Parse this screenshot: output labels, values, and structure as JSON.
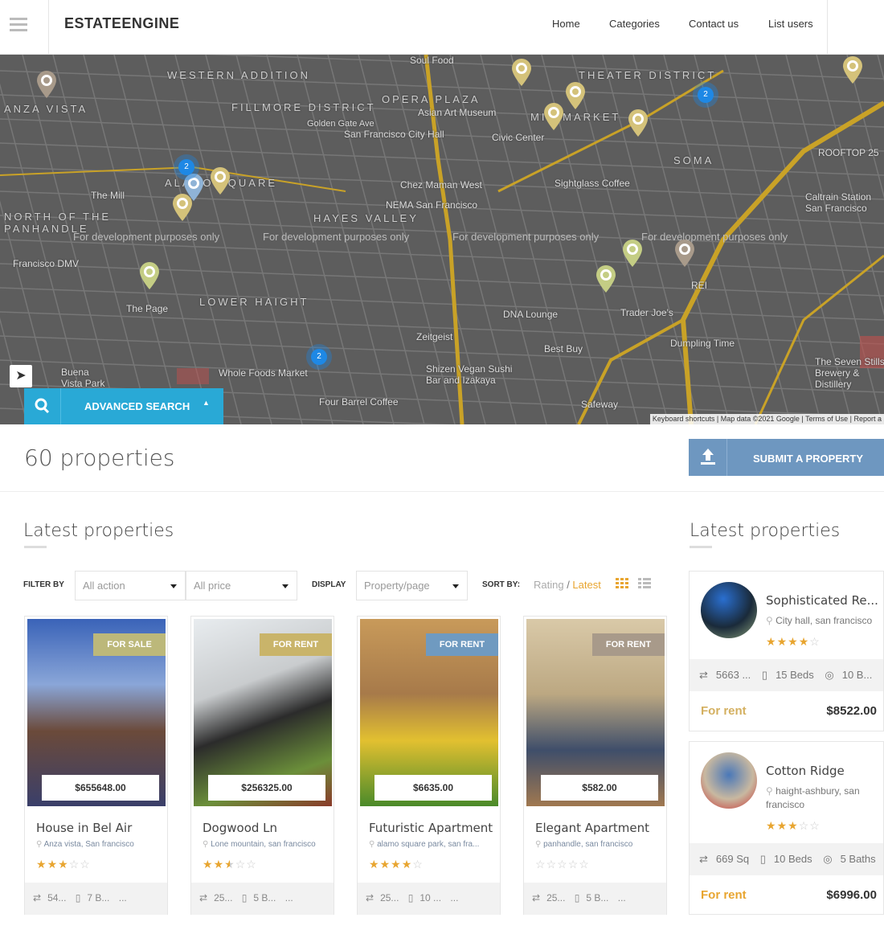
{
  "header": {
    "logo": "ESTATEENGINE",
    "nav": [
      "Home",
      "Categories",
      "Contact us",
      "List users"
    ]
  },
  "map": {
    "neighborhoods": [
      "WESTERN ADDITION",
      "ANZA VISTA",
      "FILLMORE DISTRICT",
      "OPERA PLAZA",
      "THEATER DISTRICT",
      "SOMA",
      "ALAMO SQUARE",
      "NORTH OF THE PANHANDLE",
      "HAYES VALLEY",
      "LOWER HAIGHT",
      "MID-MARKET"
    ],
    "places": [
      "Soul Food",
      "Asian Art Museum",
      "San Francisco City Hall",
      "Civic Center",
      "Sightglass Coffee",
      "Chez Maman West",
      "NEMA San Francisco",
      "Golden Gate Ave",
      "The Mill",
      "The Page",
      "Whole Foods Market",
      "Zeitgeist",
      "Shizen Vegan Sushi Bar and Izakaya",
      "Four Barrel Coffee",
      "DNA Lounge",
      "Trader Joe's",
      "Best Buy",
      "Safeway",
      "Dumpling Time",
      "The Seven Stills Brewery & Distillery",
      "ROOFTOP 25",
      "Caltrain Station San Francisco",
      "REI",
      "Buena Vista Park",
      "Francisco DMV"
    ],
    "watermark": "For development purposes only",
    "clusters": [
      "2",
      "2",
      "2"
    ],
    "attribution": [
      "Keyboard shortcuts",
      "Map data ©2021 Google",
      "Terms of Use",
      "Report a"
    ]
  },
  "advanced_search": "ADVANCED SEARCH",
  "count": "60 properties",
  "submit": "SUBMIT A PROPERTY",
  "main_title": "Latest properties",
  "side_title": "Latest properties",
  "filters": {
    "filter_by": "FILTER BY",
    "action": "All action",
    "price": "All price",
    "display": "DISPLAY",
    "per_page": "Property/page",
    "sort_by": "SORT BY:",
    "rating": "Rating",
    "slash": " / ",
    "latest": "Latest"
  },
  "colors": {
    "accent": "#29a9d6",
    "submit": "#6e97c0",
    "star": "#e8a530",
    "for_rent_text": "#d4b060"
  },
  "cards": [
    {
      "badge": "FOR SALE",
      "badge_color": "#bcb87a",
      "price": "$655648.00",
      "title": "House in Bel Air",
      "location": "Anza vista, San francisco",
      "rating": 3,
      "area": "54...",
      "beds": "7 B...",
      "more": "..."
    },
    {
      "badge": "FOR RENT",
      "badge_color": "#c9b46a",
      "price": "$256325.00",
      "title": "Dogwood Ln",
      "location": "Lone mountain, san francisco",
      "rating": 2.5,
      "area": "25...",
      "beds": "5 B...",
      "more": "..."
    },
    {
      "badge": "FOR RENT",
      "badge_color": "#6f9ac0",
      "price": "$6635.00",
      "title": "Futuristic Apartment",
      "location": "alamo square park, san fra...",
      "rating": 4,
      "area": "25...",
      "beds": "10 ...",
      "more": "..."
    },
    {
      "badge": "FOR RENT",
      "badge_color": "#a89a8a",
      "price": "$582.00",
      "title": "Elegant Apartment",
      "location": "panhandle, san francisco",
      "rating": 0,
      "area": "25...",
      "beds": "5 B...",
      "more": "..."
    }
  ],
  "side": [
    {
      "title": "Sophisticated Re...",
      "location": "City hall, san francisco",
      "rating": 4,
      "area": "5663 ...",
      "beds": "15 Beds",
      "baths": "10 B...",
      "type": "For rent",
      "price": "$8522.00"
    },
    {
      "title": "Cotton Ridge",
      "location": "haight-ashbury, san francisco",
      "rating": 3,
      "area": "669 Sq",
      "beds": "10 Beds",
      "baths": "5 Baths",
      "type": "For rent",
      "price": "$6996.00"
    }
  ]
}
